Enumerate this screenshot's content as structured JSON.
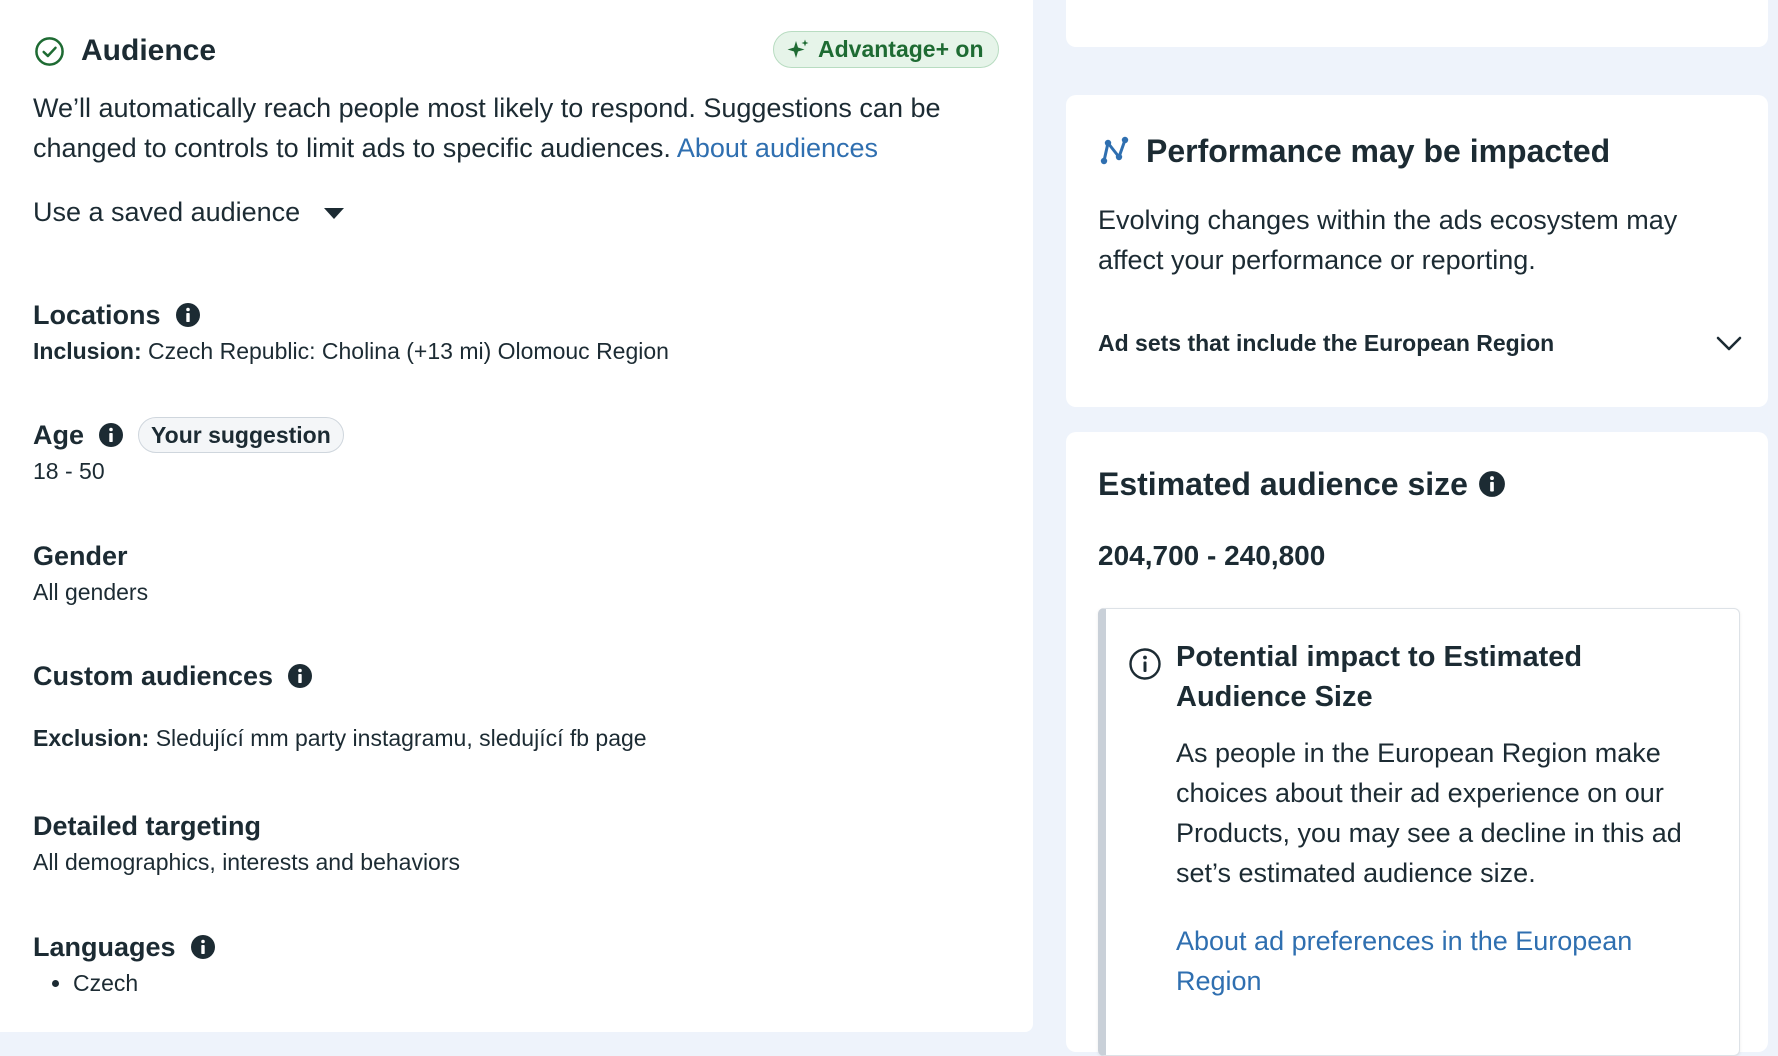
{
  "audience": {
    "title": "Audience",
    "advantage_badge": "Advantage+ on",
    "description": "We’ll automatically reach people most likely to respond. Suggestions can be changed to controls to limit ads to specific audiences.",
    "about_link": "About audiences",
    "saved_audience_label": "Use a saved audience",
    "sections": {
      "locations": {
        "title": "Locations",
        "prefix": "Inclusion:",
        "value": "Czech Republic: Cholina (+13 mi) Olomouc Region"
      },
      "age": {
        "title": "Age",
        "badge": "Your suggestion",
        "value": "18 - 50"
      },
      "gender": {
        "title": "Gender",
        "value": "All genders"
      },
      "custom_audiences": {
        "title": "Custom audiences",
        "prefix": "Exclusion:",
        "value": "Sledující mm party instagramu, sledující fb page"
      },
      "detailed_targeting": {
        "title": "Detailed targeting",
        "value": "All demographics, interests and behaviors"
      },
      "languages": {
        "title": "Languages",
        "items": [
          "Czech"
        ]
      }
    }
  },
  "performance": {
    "title": "Performance may be impacted",
    "description": "Evolving changes within the ads ecosystem may affect your performance or reporting.",
    "row_label": "Ad sets that include the European Region"
  },
  "estimate": {
    "title": "Estimated audience size",
    "range": "204,700 - 240,800",
    "impact": {
      "title": "Potential impact to Estimated Audience Size",
      "body": "As people in the European Region make choices about their ad experience on our Products, you may see a decline in this ad set’s estimated audience size.",
      "link": "About ad preferences in the European Region"
    }
  },
  "icons": {
    "check": "check-circle-icon",
    "sparkle": "sparkle-icon",
    "caret": "caret-down-icon",
    "info": "info-icon",
    "performance": "graph-nodes-icon",
    "chevron": "chevron-down-icon",
    "outline_info": "info-outline-icon"
  },
  "colors": {
    "link": "#2f6fb0",
    "advantage_green": "#1e6b33",
    "advantage_bg": "#e6f4e9",
    "page_bg": "#eef3fb",
    "text": "#1c2b33"
  }
}
